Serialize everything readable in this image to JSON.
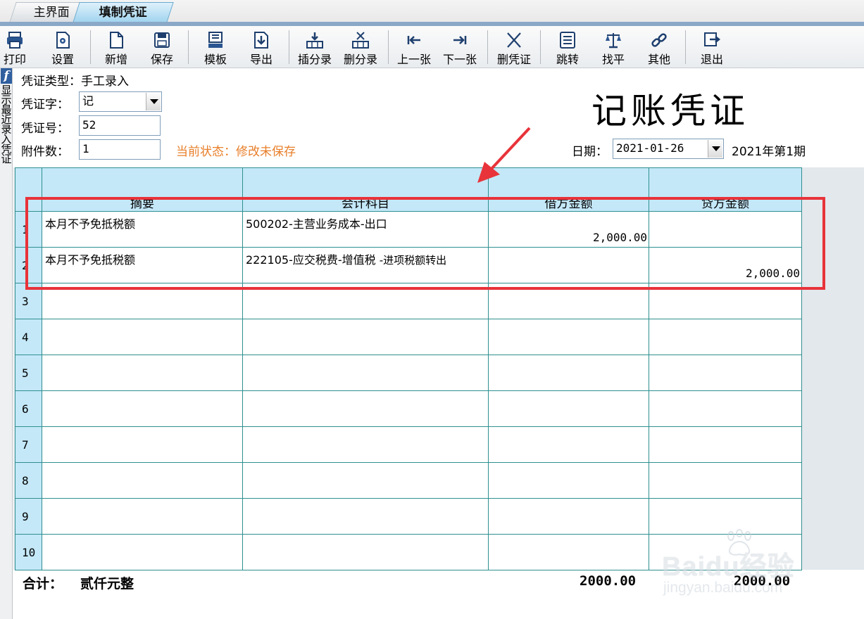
{
  "tabs": [
    {
      "label": "主界面"
    },
    {
      "label": "填制凭证"
    }
  ],
  "toolbar": {
    "print": "打印",
    "settings": "设置",
    "new": "新增",
    "save": "保存",
    "template": "模板",
    "export": "导出",
    "insert_entry": "插分录",
    "delete_entry": "删分录",
    "previous": "上一张",
    "next": "下一张",
    "delete_voucher": "删凭证",
    "jump": "跳转",
    "balance": "找平",
    "other": "其他",
    "exit": "退出"
  },
  "side_panel": {
    "badge": "f",
    "label": "显示最近录入凭证"
  },
  "header": {
    "type_label": "凭证类型：手工录入",
    "word_label": "凭证字：",
    "word_value": "记",
    "number_label": "凭证号：",
    "number_value": "52",
    "attach_label": "附件数：",
    "attach_value": "1",
    "status_text": "当前状态：修改未保存",
    "title": "记账凭证",
    "date_label": "日期：",
    "date_value": "2021-01-26",
    "period": "2021年第1期"
  },
  "grid": {
    "headers": {
      "summary": "摘要",
      "account": "会计科目",
      "debit": "借方金额",
      "credit": "贷方金额"
    },
    "rows": [
      {
        "no": "1",
        "summary": "本月不予免抵税额",
        "account": "500202-主营业务成本-出口",
        "account_sub": "",
        "debit": "2,000.00",
        "credit": ""
      },
      {
        "no": "2",
        "summary": "本月不予免抵税额",
        "account": "222105-应交税费-增值税",
        "account_sub": "-进项税额转出",
        "debit": "",
        "credit": "2,000.00"
      },
      {
        "no": "3",
        "summary": "",
        "account": "",
        "account_sub": "",
        "debit": "",
        "credit": ""
      },
      {
        "no": "4",
        "summary": "",
        "account": "",
        "account_sub": "",
        "debit": "",
        "credit": ""
      },
      {
        "no": "5",
        "summary": "",
        "account": "",
        "account_sub": "",
        "debit": "",
        "credit": ""
      },
      {
        "no": "6",
        "summary": "",
        "account": "",
        "account_sub": "",
        "debit": "",
        "credit": ""
      },
      {
        "no": "7",
        "summary": "",
        "account": "",
        "account_sub": "",
        "debit": "",
        "credit": ""
      },
      {
        "no": "8",
        "summary": "",
        "account": "",
        "account_sub": "",
        "debit": "",
        "credit": ""
      },
      {
        "no": "9",
        "summary": "",
        "account": "",
        "account_sub": "",
        "debit": "",
        "credit": ""
      },
      {
        "no": "10",
        "summary": "",
        "account": "",
        "account_sub": "",
        "debit": "",
        "credit": ""
      }
    ]
  },
  "totals": {
    "label": "合计：",
    "amount_words": "贰仟元整",
    "debit": "2000.00",
    "credit": "2000.00"
  },
  "watermark": {
    "top": "Baidu经验",
    "bottom": "jingyan.baidu.com"
  },
  "colors": {
    "header_blue": "#c4e8f8",
    "grid_line": "#2f8f8f",
    "status_orange": "#e87f2a",
    "highlight_red": "#e8333a"
  }
}
